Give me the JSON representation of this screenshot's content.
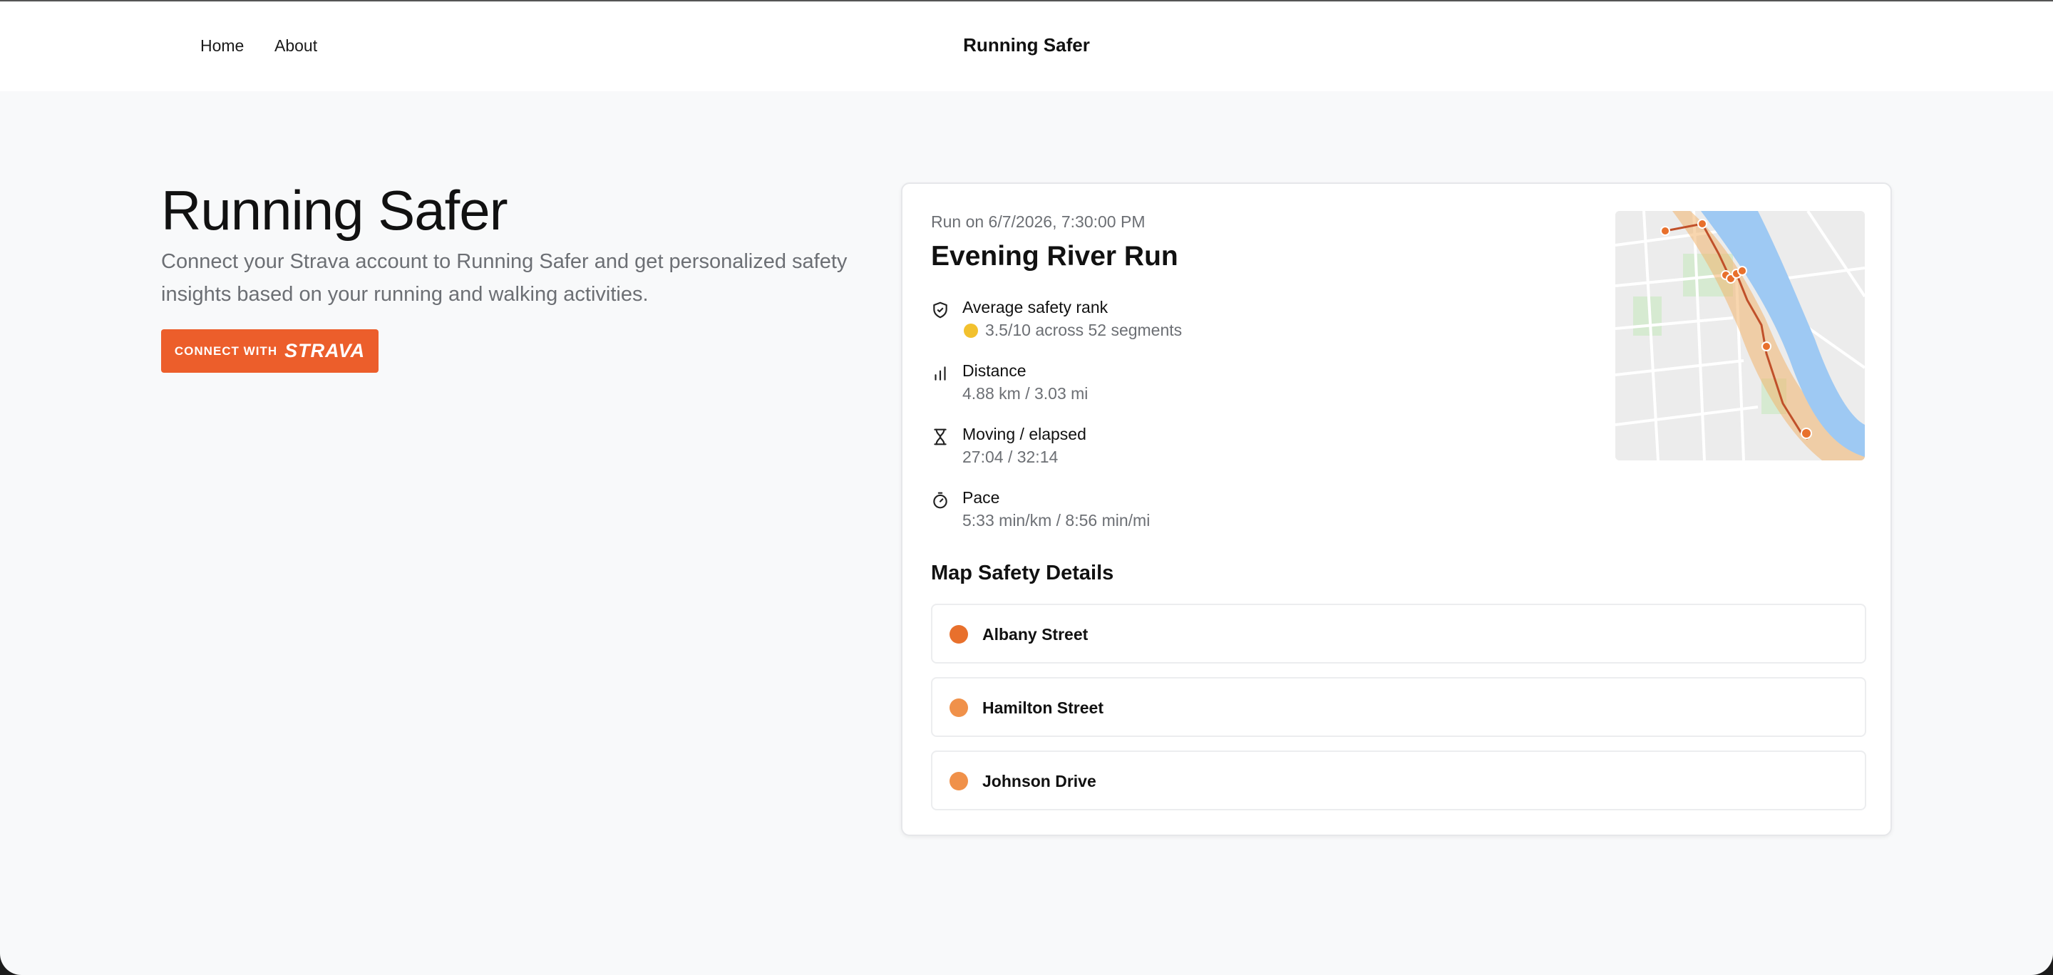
{
  "nav": {
    "home": "Home",
    "about": "About",
    "brand": "Running Safer"
  },
  "hero": {
    "title": "Running Safer",
    "description": "Connect your Strava account to Running Safer and get personalized safety insights based on your running and walking activities.",
    "connect_prefix": "CONNECT WITH",
    "connect_brand": "STRAVA"
  },
  "run": {
    "date": "Run on 6/7/2026, 7:30:00 PM",
    "name": "Evening River Run",
    "stats": [
      {
        "label": "Average safety rank",
        "value": "3.5/10 across 52 segments",
        "icon": "shield-icon"
      },
      {
        "label": "Distance",
        "value": "4.88 km / 3.03 mi",
        "icon": "bar-chart-icon"
      },
      {
        "label": "Moving / elapsed",
        "value": "27:04 / 32:14",
        "icon": "hourglass-icon"
      },
      {
        "label": "Pace",
        "value": "5:33 min/km / 8:56 min/mi",
        "icon": "stopwatch-icon"
      }
    ]
  },
  "map_section": {
    "title": "Map Safety Details",
    "streets": [
      {
        "name": "Albany Street",
        "color": "#e8702c"
      },
      {
        "name": "Hamilton Street",
        "color": "#f0914a"
      },
      {
        "name": "Johnson Drive",
        "color": "#f0914a"
      }
    ]
  },
  "colors": {
    "strava": "#ec5e2b",
    "safety_dot": "#f2c12e",
    "route": "#c0502a",
    "river": "#9ec9f3"
  }
}
